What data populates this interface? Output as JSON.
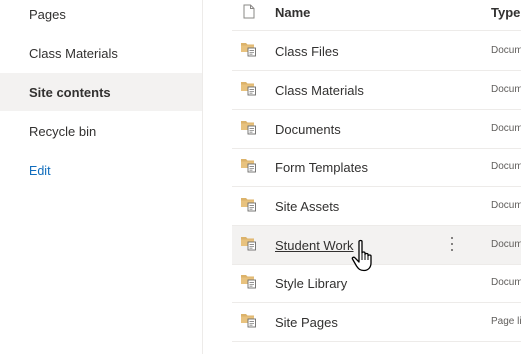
{
  "nav": {
    "items": [
      {
        "label": "Pages"
      },
      {
        "label": "Class Materials"
      },
      {
        "label": "Site contents",
        "selected": true
      },
      {
        "label": "Recycle bin"
      }
    ],
    "edit_label": "Edit"
  },
  "list": {
    "columns": {
      "name": "Name",
      "type": "Type"
    },
    "rows": [
      {
        "name": "Class Files",
        "type": "Document library",
        "icon": "document-library-icon"
      },
      {
        "name": "Class Materials",
        "type": "Document library",
        "icon": "document-library-icon"
      },
      {
        "name": "Documents",
        "type": "Document library",
        "icon": "document-library-icon"
      },
      {
        "name": "Form Templates",
        "type": "Document library",
        "icon": "document-library-icon"
      },
      {
        "name": "Site Assets",
        "type": "Document library",
        "icon": "document-library-icon"
      },
      {
        "name": "Student Work",
        "type": "Document library",
        "icon": "document-library-icon",
        "hovered": true
      },
      {
        "name": "Style Library",
        "type": "Document library",
        "icon": "document-library-icon"
      },
      {
        "name": "Site Pages",
        "type": "Page library",
        "icon": "document-library-icon"
      }
    ]
  },
  "colors": {
    "selected_nav_bg": "#f3f2f1",
    "link": "#0f6cbd",
    "folder": "#dcb36b"
  }
}
